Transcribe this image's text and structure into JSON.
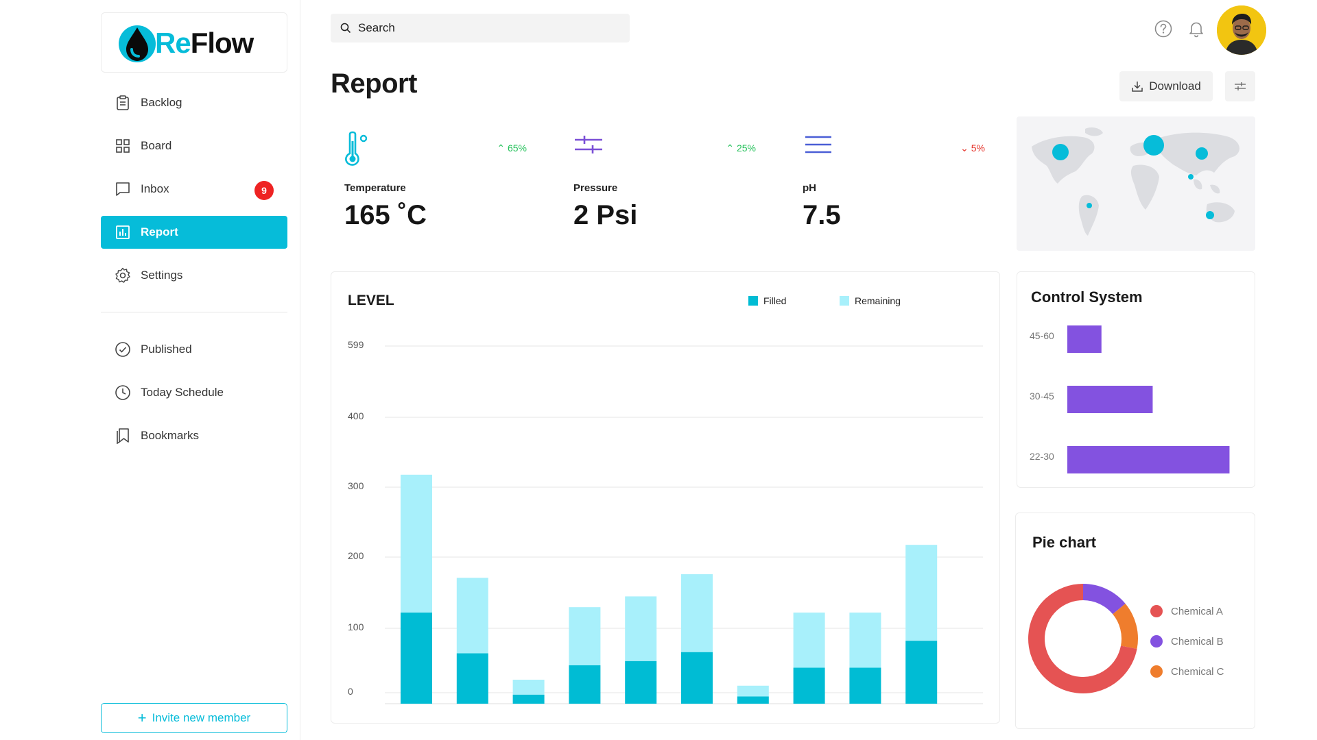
{
  "brand": {
    "name": "ReFlow"
  },
  "sidebar": {
    "items": [
      {
        "label": "Backlog",
        "icon": "clipboard-icon"
      },
      {
        "label": "Board",
        "icon": "grid-icon"
      },
      {
        "label": "Inbox",
        "icon": "message-icon",
        "badge": "9"
      },
      {
        "label": "Report",
        "icon": "bar-chart-icon",
        "active": true
      },
      {
        "label": "Settings",
        "icon": "gear-icon"
      }
    ],
    "secondary": [
      {
        "label": "Published",
        "icon": "check-circle-icon"
      },
      {
        "label": "Today Schedule",
        "icon": "clock-icon"
      },
      {
        "label": "Bookmarks",
        "icon": "bookmark-icon"
      }
    ],
    "invite_label": "Invite new member"
  },
  "search": {
    "placeholder": "Search"
  },
  "header": {
    "title": "Report",
    "download_label": "Download"
  },
  "stats": [
    {
      "label": "Temperature",
      "value": "165 ˚C",
      "change": "65%",
      "trend": "up",
      "icon": "thermometer-icon",
      "bg": "#e9fbfc",
      "color": "#06bcd9"
    },
    {
      "label": "Pressure",
      "value": "2 Psi",
      "change": "25%",
      "trend": "up",
      "icon": "sliders-icon",
      "bg": "#f3f2fb",
      "color": "#7a4fd6"
    },
    {
      "label": "pH",
      "value": "7.5",
      "change": "5%",
      "trend": "down",
      "icon": "menu-lines-icon",
      "bg": "#eff1fb",
      "color": "#4a5ed6"
    }
  ],
  "colors": {
    "accent": "#06bcd9",
    "filled": "#00bcd4",
    "remaining": "#a8f0fb",
    "purple": "#8352e0",
    "up": "#24c15a",
    "down": "#e5332a"
  },
  "level_chart": {
    "title": "LEVEL",
    "legend": {
      "filled": "Filled",
      "remaining": "Remaining"
    }
  },
  "control_system": {
    "title": "Control System"
  },
  "pie": {
    "title": "Pie chart"
  },
  "chart_data": [
    {
      "type": "bar",
      "stacked": true,
      "title": "LEVEL",
      "y_ticks": [
        "599",
        "400",
        "300",
        "200",
        "100",
        "0"
      ],
      "ylim": [
        0,
        599
      ],
      "series": [
        {
          "name": "Filled",
          "values": [
            152,
            84,
            15,
            64,
            71,
            86,
            12,
            60,
            60,
            105
          ]
        },
        {
          "name": "Remaining",
          "values": [
            230,
            126,
            25,
            97,
            108,
            130,
            18,
            92,
            92,
            160
          ]
        }
      ],
      "legend": "top-right",
      "grid": true
    },
    {
      "type": "bar",
      "orientation": "horizontal",
      "title": "Control System",
      "categories": [
        "45-60",
        "30-45",
        "22-30"
      ],
      "values": [
        20,
        50,
        95
      ],
      "xlim": [
        0,
        100
      ]
    },
    {
      "type": "pie",
      "donut": true,
      "title": "Pie chart",
      "labels": [
        "Chemical A",
        "Chemical B",
        "Chemical C"
      ],
      "values": [
        72,
        14,
        14
      ],
      "colors": [
        "#e55353",
        "#8352e0",
        "#ef7d2d"
      ]
    }
  ],
  "map": {
    "markers": [
      {
        "size": "medium",
        "region": "north-america"
      },
      {
        "size": "large",
        "region": "europe"
      },
      {
        "size": "medium",
        "region": "asia"
      },
      {
        "size": "small",
        "region": "south-asia"
      },
      {
        "size": "small",
        "region": "south-america"
      },
      {
        "size": "small",
        "region": "australia"
      }
    ]
  }
}
